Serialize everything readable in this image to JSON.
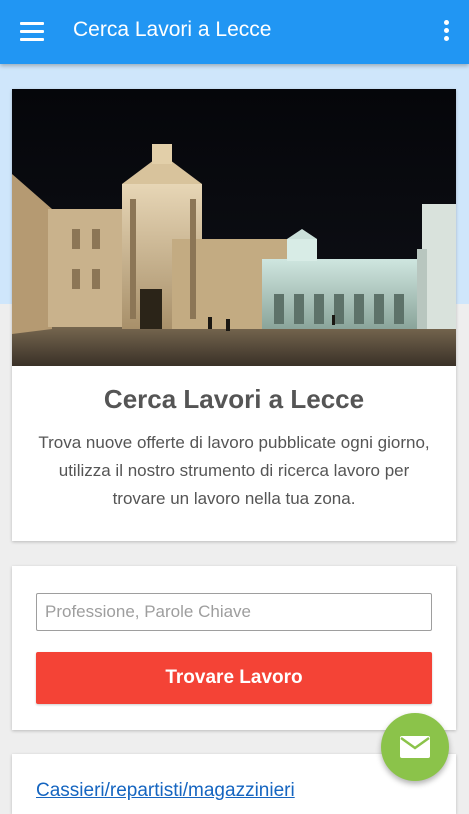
{
  "appbar": {
    "title": "Cerca Lavori a Lecce",
    "menu_icon": "menu-icon",
    "more_icon": "more-vertical-icon"
  },
  "hero": {
    "image": "lecce-cathedral-square-night-photo",
    "title": "Cerca Lavori a Lecce",
    "description": "Trova nuove offerte di lavoro pubblicate ogni giorno, utilizza il nostro strumento di ricerca lavoro per trovare un lavoro nella tua zona."
  },
  "search": {
    "placeholder": "Professione, Parole Chiave",
    "value": "",
    "button_label": "Trovare Lavoro"
  },
  "categories": {
    "first_link": "Cassieri/repartisti/magazzinieri"
  },
  "fab": {
    "icon": "mail-icon"
  },
  "colors": {
    "appbar": "#2196f3",
    "button": "#f44336",
    "fab": "#8bc34a",
    "link": "#1565c0"
  }
}
